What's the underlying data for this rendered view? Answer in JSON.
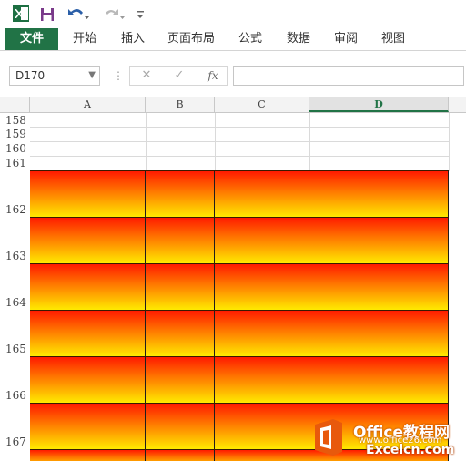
{
  "toolbar": {
    "app_icon": "excel-icon",
    "save_icon": "save-icon",
    "undo_icon": "undo-icon",
    "redo_icon": "redo-icon",
    "customize_icon": "customize-icon"
  },
  "ribbon": {
    "tabs": [
      {
        "label": "文件"
      },
      {
        "label": "开始"
      },
      {
        "label": "插入"
      },
      {
        "label": "页面布局"
      },
      {
        "label": "公式"
      },
      {
        "label": "数据"
      },
      {
        "label": "审阅"
      },
      {
        "label": "视图"
      }
    ],
    "file_color": "#217346"
  },
  "formula_bar": {
    "name_box": "D170",
    "cancel": "✕",
    "enter": "✓",
    "fx": "fx",
    "value": ""
  },
  "sheet": {
    "columns": [
      "A",
      "B",
      "C",
      "D"
    ],
    "selected_column": "D",
    "rows": [
      "158",
      "159",
      "160",
      "161",
      "162",
      "163",
      "164",
      "165",
      "166",
      "167"
    ],
    "gradient_colors": [
      "#ff1a00",
      "#ff7a00",
      "#ffea00"
    ]
  },
  "watermark": {
    "line1": "Office教程网",
    "line2": "www.office26.com",
    "line3": "Excelcn.com"
  }
}
